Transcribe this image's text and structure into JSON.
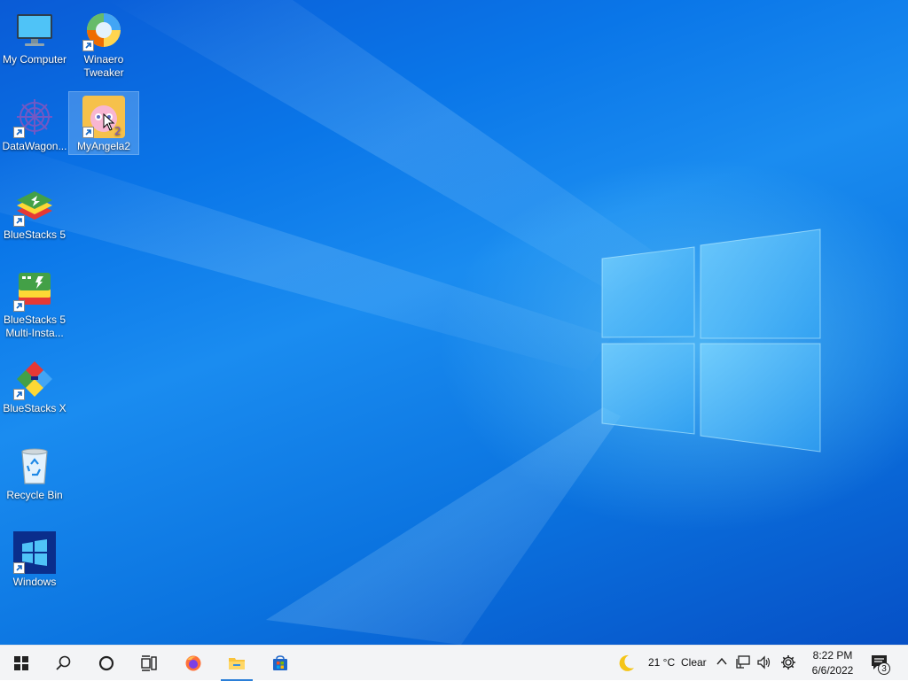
{
  "desktop": {
    "icons": [
      {
        "label": "My Computer",
        "icon": "monitor-icon"
      },
      {
        "label": "Winaero Tweaker",
        "icon": "winaero-tweaker-icon"
      },
      {
        "label": "DataWagon...",
        "icon": "datawagon-icon"
      },
      {
        "label": "MyAngela2",
        "icon": "my-angela-icon"
      },
      {
        "label": "BlueStacks 5",
        "icon": "bluestacks-icon"
      },
      {
        "label": "BlueStacks 5 Multi-Insta...",
        "icon": "bluestacks-multi-instance-icon"
      },
      {
        "label": "BlueStacks X",
        "icon": "bluestacks-x-icon"
      },
      {
        "label": "Recycle Bin",
        "icon": "recycle-bin-icon"
      },
      {
        "label": "Windows",
        "icon": "windows-logo-icon"
      }
    ]
  },
  "taskbar": {
    "start": "windows-start-icon",
    "search": "search-icon",
    "cortana": "cortana-circle-icon",
    "task_view": "task-view-icon",
    "pinned": [
      "firefox-icon",
      "file-explorer-icon",
      "microsoft-store-icon"
    ],
    "active_app": "file-explorer-icon"
  },
  "tray": {
    "weather_icon": "moon-icon",
    "temperature": "21 °C",
    "condition": "Clear",
    "time": "8:22 PM",
    "date": "6/6/2022",
    "notification_count": "3"
  },
  "colors": {
    "wallpaper_primary": "#0a76e8",
    "taskbar_bg": "#f3f4f6",
    "active_indicator": "#2b7fd8"
  }
}
